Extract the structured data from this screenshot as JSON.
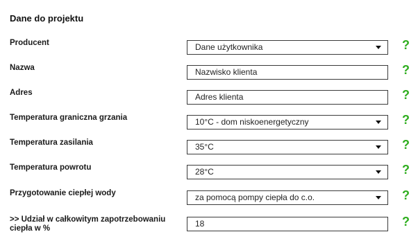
{
  "section": {
    "title": "Dane do projektu"
  },
  "help_label": "?",
  "accent_color": "#2fae1f",
  "fields": [
    {
      "label": "Producent",
      "type": "select",
      "value": "Dane użytkownika",
      "icon": "chevron-down-icon"
    },
    {
      "label": "Nazwa",
      "type": "text",
      "value": "Nazwisko klienta"
    },
    {
      "label": "Adres",
      "type": "text",
      "value": "Adres klienta"
    },
    {
      "label": "Temperatura graniczna grzania",
      "type": "select",
      "value": "10°C - dom niskoenergetyczny",
      "icon": "chevron-down-icon"
    },
    {
      "label": "Temperatura zasilania",
      "type": "select",
      "value": "35°C",
      "icon": "chevron-down-icon"
    },
    {
      "label": "Temperatura powrotu",
      "type": "select",
      "value": "28°C",
      "icon": "chevron-down-icon"
    },
    {
      "label": "Przygotowanie ciepłej wody",
      "type": "select",
      "value": "za pomocą pompy ciepła do c.o.",
      "icon": "chevron-down-icon"
    },
    {
      "label": ">> Udział w całkowitym zapotrzebowaniu ciepła w %",
      "type": "text",
      "value": "18"
    }
  ]
}
